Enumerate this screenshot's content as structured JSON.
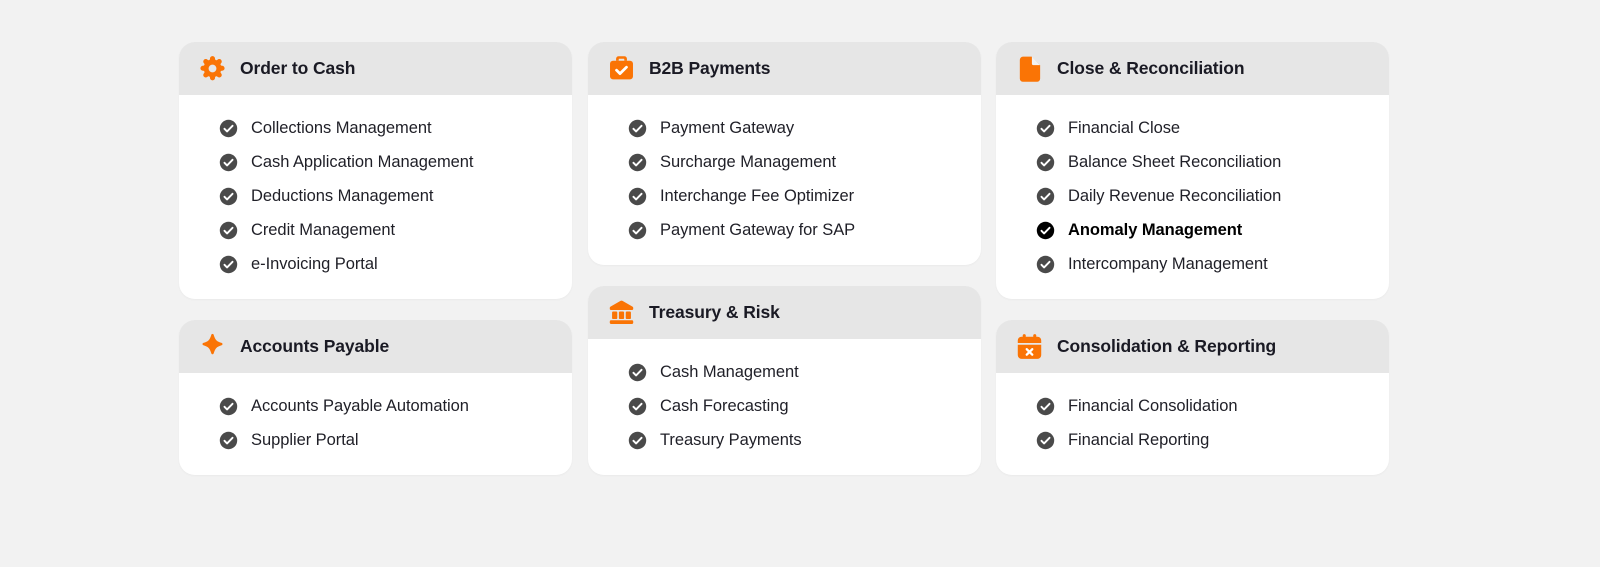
{
  "theme": {
    "page_background": "#f2f2f2",
    "card_background": "#ffffff",
    "card_header_background": "#e6e6e6",
    "accent_orange": "#fa7405",
    "check_default": "#4a4a4a",
    "check_highlight": "#000000",
    "title_color": "#1a1a24",
    "label_color": "#1f1f27"
  },
  "columns": [
    {
      "cards": [
        {
          "title": "Order to Cash",
          "icon": "gear-icon",
          "items": [
            {
              "label": "Collections Management",
              "highlight": false
            },
            {
              "label": "Cash Application Management",
              "highlight": false
            },
            {
              "label": "Deductions Management",
              "highlight": false
            },
            {
              "label": "Credit Management",
              "highlight": false
            },
            {
              "label": "e-Invoicing Portal",
              "highlight": false
            }
          ]
        },
        {
          "title": "Accounts Payable",
          "icon": "sparkle-icon",
          "items": [
            {
              "label": "Accounts Payable Automation",
              "highlight": false
            },
            {
              "label": "Supplier Portal",
              "highlight": false
            }
          ]
        }
      ]
    },
    {
      "cards": [
        {
          "title": "B2B Payments",
          "icon": "briefcase-check-icon",
          "items": [
            {
              "label": "Payment Gateway",
              "highlight": false
            },
            {
              "label": "Surcharge Management",
              "highlight": false
            },
            {
              "label": "Interchange Fee Optimizer",
              "highlight": false
            },
            {
              "label": "Payment Gateway for SAP",
              "highlight": false
            }
          ]
        },
        {
          "title": "Treasury & Risk",
          "icon": "bank-icon",
          "items": [
            {
              "label": "Cash Management",
              "highlight": false
            },
            {
              "label": "Cash Forecasting",
              "highlight": false
            },
            {
              "label": "Treasury Payments",
              "highlight": false
            }
          ]
        }
      ]
    },
    {
      "cards": [
        {
          "title": "Close & Reconciliation",
          "icon": "document-icon",
          "items": [
            {
              "label": "Financial Close",
              "highlight": false
            },
            {
              "label": "Balance Sheet Reconciliation",
              "highlight": false
            },
            {
              "label": "Daily Revenue Reconciliation",
              "highlight": false
            },
            {
              "label": "Anomaly Management",
              "highlight": true
            },
            {
              "label": "Intercompany Management",
              "highlight": false
            }
          ]
        },
        {
          "title": "Consolidation & Reporting",
          "icon": "calendar-x-icon",
          "items": [
            {
              "label": "Financial Consolidation",
              "highlight": false
            },
            {
              "label": "Financial Reporting",
              "highlight": false
            }
          ]
        }
      ]
    }
  ]
}
